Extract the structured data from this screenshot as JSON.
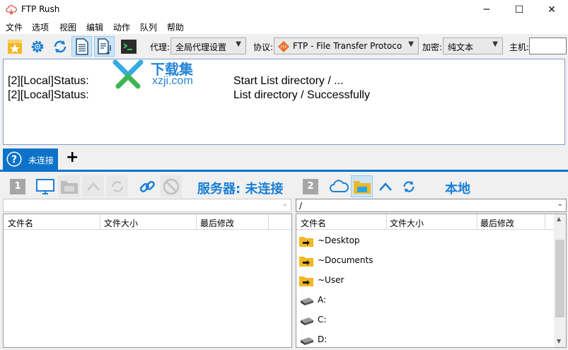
{
  "window": {
    "title": "FTP Rush"
  },
  "window_controls": {
    "minimize": "─",
    "maximize": "☐",
    "close": "✕"
  },
  "menu": [
    "文件",
    "选项",
    "视图",
    "编辑",
    "动作",
    "队列",
    "帮助"
  ],
  "toolbar": {
    "proxy_label": "代理:",
    "proxy_value": "全局代理设置",
    "protocol_label": "协议:",
    "protocol_value": "FTP - File Transfer Protoco",
    "encryption_label": "加密:",
    "encryption_value": "纯文本",
    "host_label": "主机:",
    "host_value": ""
  },
  "log": {
    "lines": [
      {
        "source": "[2][Local]Status:",
        "message": "Start List directory / ..."
      },
      {
        "source": "[2][Local]Status:",
        "message": "List directory / Successfully"
      }
    ],
    "watermark": {
      "cn": "下载集",
      "domain": "xzji.com"
    }
  },
  "tabs": {
    "active_label": "未连接",
    "add_label": "+"
  },
  "server_pane": {
    "number": "1",
    "title": "服务器: 未连接",
    "path": "",
    "columns": [
      "文件名",
      "文件大小",
      "最后修改"
    ]
  },
  "local_pane": {
    "number": "2",
    "title": "本地",
    "path": "/",
    "columns": [
      "文件名",
      "文件大小",
      "最后修改"
    ],
    "items": [
      {
        "name": "~Desktop",
        "type": "folder-link"
      },
      {
        "name": "~Documents",
        "type": "folder-link"
      },
      {
        "name": "~User",
        "type": "folder-link"
      },
      {
        "name": "A:",
        "type": "drive"
      },
      {
        "name": "C:",
        "type": "drive"
      },
      {
        "name": "D:",
        "type": "drive"
      }
    ]
  },
  "colors": {
    "accent": "#0c73c9",
    "pane_title": "#1a7fd6",
    "folder": "#f2b824"
  }
}
